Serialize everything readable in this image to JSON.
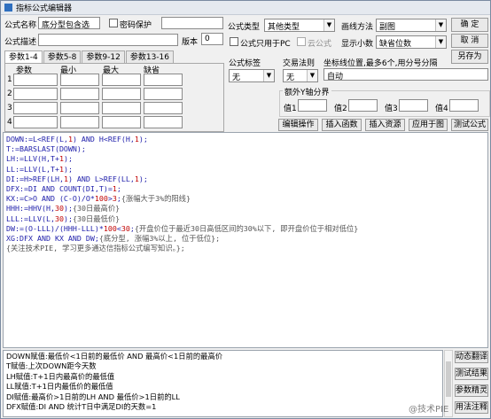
{
  "window": {
    "title": "指标公式编辑器"
  },
  "top": {
    "name_label": "公式名称",
    "name_value": "底分型包含选",
    "password_label": "密码保护",
    "desc_label": "公式描述",
    "desc_value": "",
    "version_label": "版本",
    "version_value": "0",
    "type_label": "公式类型",
    "type_value": "其他类型",
    "draw_label": "画线方法",
    "draw_value": "副图",
    "pc_only_label": "公式只用于PC",
    "cloud_label": "云公式",
    "decimals_label": "显示小数",
    "decimals_value": "缺省位数",
    "confirm": "确 定",
    "cancel": "取 消",
    "save_as": "另存为"
  },
  "tabs": [
    "参数1-4",
    "参数5-8",
    "参数9-12",
    "参数13-16"
  ],
  "params": {
    "headers": [
      "参数",
      "最小",
      "最大",
      "缺省"
    ],
    "rows": [
      "1",
      "2",
      "3",
      "4"
    ]
  },
  "right": {
    "tag_label": "公式标签",
    "tag_value": "无",
    "rule_label": "交易法则",
    "rule_value": "无",
    "coord_label": "坐标线位置,最多6个,用分号分隔",
    "coord_value": "自动",
    "yaxis_label": "额外Y轴分界",
    "val_labels": [
      "值1",
      "值2",
      "值3",
      "值4"
    ]
  },
  "actions": [
    "编辑操作",
    "插入函数",
    "插入资源",
    "应用于图",
    "测试公式"
  ],
  "code_lines": [
    [
      [
        "k",
        "DOWN:=L<REF(L,"
      ],
      [
        "n",
        "1"
      ],
      [
        "k",
        ") AND H<REF(H,"
      ],
      [
        "n",
        "1"
      ],
      [
        "k",
        ");"
      ]
    ],
    [
      [
        "k",
        "T:=BARSLAST(DOWN);"
      ]
    ],
    [
      [
        "k",
        "LH:=LLV(H,T+"
      ],
      [
        "n",
        "1"
      ],
      [
        "k",
        ");"
      ]
    ],
    [
      [
        "k",
        "LL:=LLV(L,T+"
      ],
      [
        "n",
        "1"
      ],
      [
        "k",
        ");"
      ]
    ],
    [
      [
        "k",
        "DI:=H>REF(LH,"
      ],
      [
        "n",
        "1"
      ],
      [
        "k",
        ") AND L>REF(LL,"
      ],
      [
        "n",
        "1"
      ],
      [
        "k",
        ");"
      ]
    ],
    [
      [
        "k",
        "DFX:=DI AND COUNT(DI,T)="
      ],
      [
        "n",
        "1"
      ],
      [
        "k",
        ";"
      ]
    ],
    [
      [
        "k",
        "KX:=C>O AND (C-O)/O*"
      ],
      [
        "n",
        "100"
      ],
      [
        "k",
        ">"
      ],
      [
        "n",
        "3"
      ],
      [
        "k",
        ";"
      ],
      [
        "c",
        "{涨幅大于3%的阳线}"
      ]
    ],
    [
      [
        "k",
        "HHH:=HHV(H,"
      ],
      [
        "n",
        "30"
      ],
      [
        "k",
        ");"
      ],
      [
        "c",
        "{30日最高价}"
      ]
    ],
    [
      [
        "k",
        "LLL:=LLV(L,"
      ],
      [
        "n",
        "30"
      ],
      [
        "k",
        ");"
      ],
      [
        "c",
        "{30日最低价}"
      ]
    ],
    [
      [
        "k",
        "DW:=(O-LLL)/(HHH-LLL)*"
      ],
      [
        "n",
        "100"
      ],
      [
        "k",
        "<"
      ],
      [
        "n",
        "30"
      ],
      [
        "k",
        ";"
      ],
      [
        "c",
        "{开盘价位于最近30日高低区间的30%以下, 即开盘价位于相对低位}"
      ]
    ],
    [
      [
        "k",
        "XG:DFX AND KX AND DW;"
      ],
      [
        "c",
        "{底分型, 涨幅3%以上, 位于低位};"
      ]
    ],
    [
      [
        "c",
        "{关注技术PIE, 学习更多通达信指标公式编写知识。};"
      ]
    ]
  ],
  "bottom_lines": [
    "DOWN赋值:最低价<1日前的最低价 AND 最高价<1日前的最高价",
    "T赋值:上次DOWN距今天数",
    "LH赋值:T+1日内最高价的最低值",
    "LL赋值:T+1日内最低价的最低值",
    "DI赋值:最高价>1日前的LH AND 最低价>1日前的LL",
    "DFX赋值:DI AND 统计T日中满足DI的天数=1"
  ],
  "side_buttons": [
    "动态翻译",
    "测试结果",
    "参数精灵",
    "用法注释"
  ],
  "watermark": "@技术PIE"
}
